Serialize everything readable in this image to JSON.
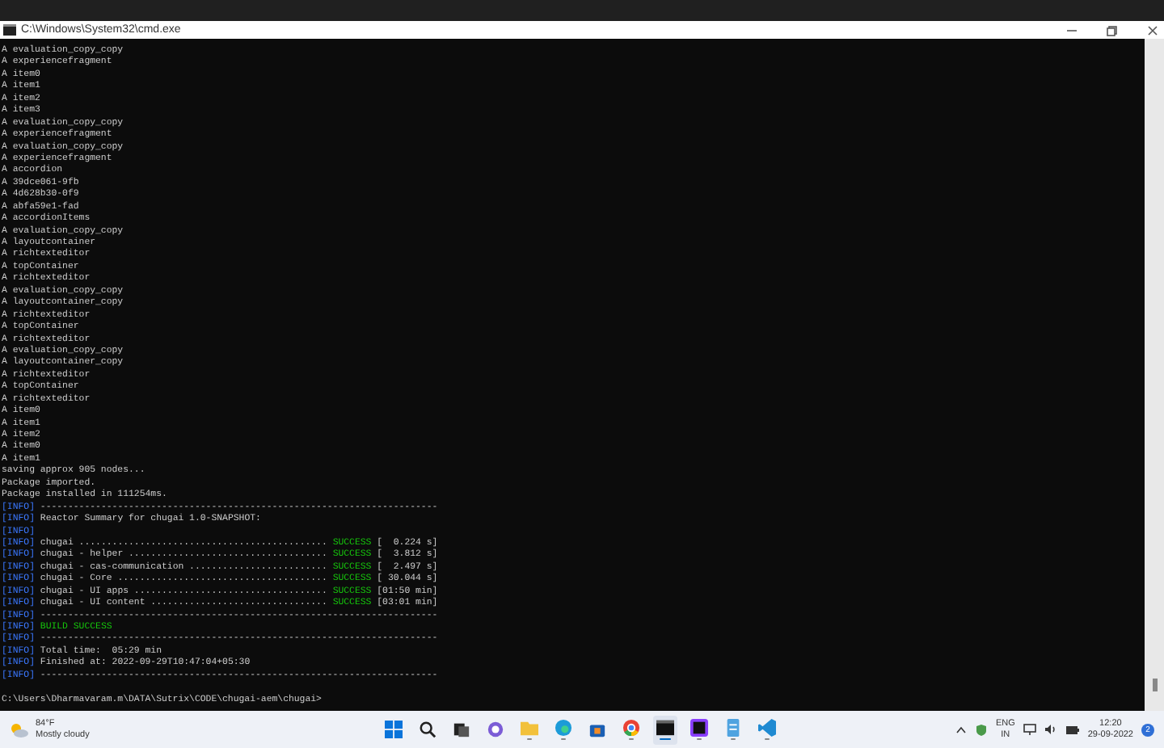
{
  "window": {
    "title": "C:\\Windows\\System32\\cmd.exe"
  },
  "console": {
    "lines": [
      {
        "kind": "plain",
        "text": "A evaluation_copy_copy"
      },
      {
        "kind": "plain",
        "text": "A experiencefragment"
      },
      {
        "kind": "plain",
        "text": "A item0"
      },
      {
        "kind": "plain",
        "text": "A item1"
      },
      {
        "kind": "plain",
        "text": "A item2"
      },
      {
        "kind": "plain",
        "text": "A item3"
      },
      {
        "kind": "plain",
        "text": "A evaluation_copy_copy"
      },
      {
        "kind": "plain",
        "text": "A experiencefragment"
      },
      {
        "kind": "plain",
        "text": "A evaluation_copy_copy"
      },
      {
        "kind": "plain",
        "text": "A experiencefragment"
      },
      {
        "kind": "plain",
        "text": "A accordion"
      },
      {
        "kind": "plain",
        "text": "A 39dce061-9fb"
      },
      {
        "kind": "plain",
        "text": "A 4d628b30-0f9"
      },
      {
        "kind": "plain",
        "text": "A abfa59e1-fad"
      },
      {
        "kind": "plain",
        "text": "A accordionItems"
      },
      {
        "kind": "plain",
        "text": "A evaluation_copy_copy"
      },
      {
        "kind": "plain",
        "text": "A layoutcontainer"
      },
      {
        "kind": "plain",
        "text": "A richtexteditor"
      },
      {
        "kind": "plain",
        "text": "A topContainer"
      },
      {
        "kind": "plain",
        "text": "A richtexteditor"
      },
      {
        "kind": "plain",
        "text": "A evaluation_copy_copy"
      },
      {
        "kind": "plain",
        "text": "A layoutcontainer_copy"
      },
      {
        "kind": "plain",
        "text": "A richtexteditor"
      },
      {
        "kind": "plain",
        "text": "A topContainer"
      },
      {
        "kind": "plain",
        "text": "A richtexteditor"
      },
      {
        "kind": "plain",
        "text": "A evaluation_copy_copy"
      },
      {
        "kind": "plain",
        "text": "A layoutcontainer_copy"
      },
      {
        "kind": "plain",
        "text": "A richtexteditor"
      },
      {
        "kind": "plain",
        "text": "A topContainer"
      },
      {
        "kind": "plain",
        "text": "A richtexteditor"
      },
      {
        "kind": "plain",
        "text": "A item0"
      },
      {
        "kind": "plain",
        "text": "A item1"
      },
      {
        "kind": "plain",
        "text": "A item2"
      },
      {
        "kind": "plain",
        "text": "A item0"
      },
      {
        "kind": "plain",
        "text": "A item1"
      },
      {
        "kind": "plain",
        "text": "saving approx 905 nodes..."
      },
      {
        "kind": "plain",
        "text": "Package imported."
      },
      {
        "kind": "plain",
        "text": "Package installed in 111254ms."
      },
      {
        "kind": "info",
        "tag": "[INFO]",
        "text": "------------------------------------------------------------------------"
      },
      {
        "kind": "info",
        "tag": "[INFO]",
        "text": "Reactor Summary for chugai 1.0-SNAPSHOT:"
      },
      {
        "kind": "info",
        "tag": "[INFO]"
      },
      {
        "kind": "result",
        "tag": "[INFO]",
        "text": "chugai .............................................",
        "status": "SUCCESS",
        "time": "[  0.224 s]"
      },
      {
        "kind": "result",
        "tag": "[INFO]",
        "text": "chugai - helper ....................................",
        "status": "SUCCESS",
        "time": "[  3.812 s]"
      },
      {
        "kind": "result",
        "tag": "[INFO]",
        "text": "chugai - cas-communication .........................",
        "status": "SUCCESS",
        "time": "[  2.497 s]"
      },
      {
        "kind": "result",
        "tag": "[INFO]",
        "text": "chugai - Core ......................................",
        "status": "SUCCESS",
        "time": "[ 30.044 s]"
      },
      {
        "kind": "result",
        "tag": "[INFO]",
        "text": "chugai - UI apps ...................................",
        "status": "SUCCESS",
        "time": "[01:50 min]"
      },
      {
        "kind": "result",
        "tag": "[INFO]",
        "text": "chugai - UI content ................................",
        "status": "SUCCESS",
        "time": "[03:01 min]"
      },
      {
        "kind": "info",
        "tag": "[INFO]",
        "text": "------------------------------------------------------------------------"
      },
      {
        "kind": "build",
        "tag": "[INFO]",
        "text": "BUILD SUCCESS"
      },
      {
        "kind": "info",
        "tag": "[INFO]",
        "text": "------------------------------------------------------------------------"
      },
      {
        "kind": "info",
        "tag": "[INFO]",
        "text": "Total time:  05:29 min"
      },
      {
        "kind": "info",
        "tag": "[INFO]",
        "text": "Finished at: 2022-09-29T10:47:04+05:30"
      },
      {
        "kind": "info",
        "tag": "[INFO]",
        "text": "------------------------------------------------------------------------"
      },
      {
        "kind": "blank"
      },
      {
        "kind": "plain",
        "text": "C:\\Users\\Dharmavaram.m\\DATA\\Sutrix\\CODE\\chugai-aem\\chugai>"
      }
    ]
  },
  "taskbar": {
    "weather": {
      "temp": "84°F",
      "condition": "Mostly cloudy"
    },
    "apps": [
      {
        "kind": "start",
        "active": false,
        "running": false
      },
      {
        "kind": "search",
        "active": false,
        "running": false
      },
      {
        "kind": "taskview",
        "active": false,
        "running": false
      },
      {
        "kind": "chat",
        "active": false,
        "running": false
      },
      {
        "kind": "folder",
        "active": false,
        "running": true
      },
      {
        "kind": "edge",
        "active": false,
        "running": true
      },
      {
        "kind": "store",
        "active": false,
        "running": false
      },
      {
        "kind": "chrome",
        "active": false,
        "running": true
      },
      {
        "kind": "terminal",
        "active": true,
        "running": true
      },
      {
        "kind": "ide",
        "active": false,
        "running": true
      },
      {
        "kind": "notepad",
        "active": false,
        "running": true
      },
      {
        "kind": "vscode",
        "active": false,
        "running": true
      }
    ],
    "tray": {
      "lang": "ENG",
      "region": "IN",
      "time": "12:20",
      "date": "29-09-2022",
      "notifications": "2"
    }
  }
}
